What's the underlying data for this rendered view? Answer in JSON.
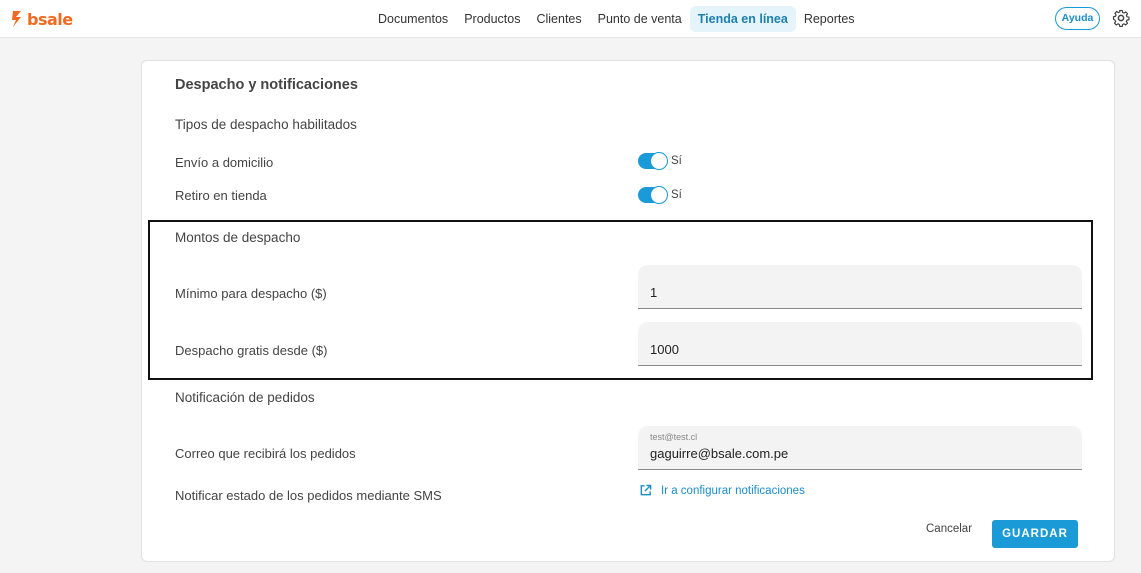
{
  "brand": {
    "name": "bsale",
    "color": "#f26a21"
  },
  "nav": {
    "items": [
      {
        "label": "Documentos"
      },
      {
        "label": "Productos"
      },
      {
        "label": "Clientes"
      },
      {
        "label": "Punto de venta"
      },
      {
        "label": "Tienda en línea",
        "active": true
      },
      {
        "label": "Reportes"
      }
    ],
    "help_label": "Ayuda",
    "settings_icon": "gear-icon"
  },
  "card": {
    "title": "Despacho y notificaciones",
    "dispatch_types": {
      "heading": "Tipos de despacho habilitados",
      "home_delivery": {
        "label": "Envío a domicilio",
        "enabled": true,
        "state_text": "Sí"
      },
      "store_pickup": {
        "label": "Retiro en tienda",
        "enabled": true,
        "state_text": "Sí"
      }
    },
    "amounts": {
      "heading": "Montos de despacho",
      "minimum": {
        "label": "Mínimo para despacho ($)",
        "value": "1"
      },
      "free_from": {
        "label": "Despacho gratis desde ($)",
        "value": "1000"
      }
    },
    "notifications": {
      "heading": "Notificación de pedidos",
      "email": {
        "label": "Correo que recibirá los pedidos",
        "placeholder": "test@test.cl",
        "value": "gaguirre@bsale.com.pe"
      },
      "sms": {
        "label": "Notificar estado de los pedidos mediante SMS",
        "link_text": "Ir a configurar notificaciones",
        "link_icon": "external-link-icon"
      }
    },
    "actions": {
      "cancel_label": "Cancelar",
      "save_label": "GUARDAR"
    }
  },
  "colors": {
    "accent": "#1a9ad6",
    "active_tab_bg": "#e4f4fa"
  }
}
